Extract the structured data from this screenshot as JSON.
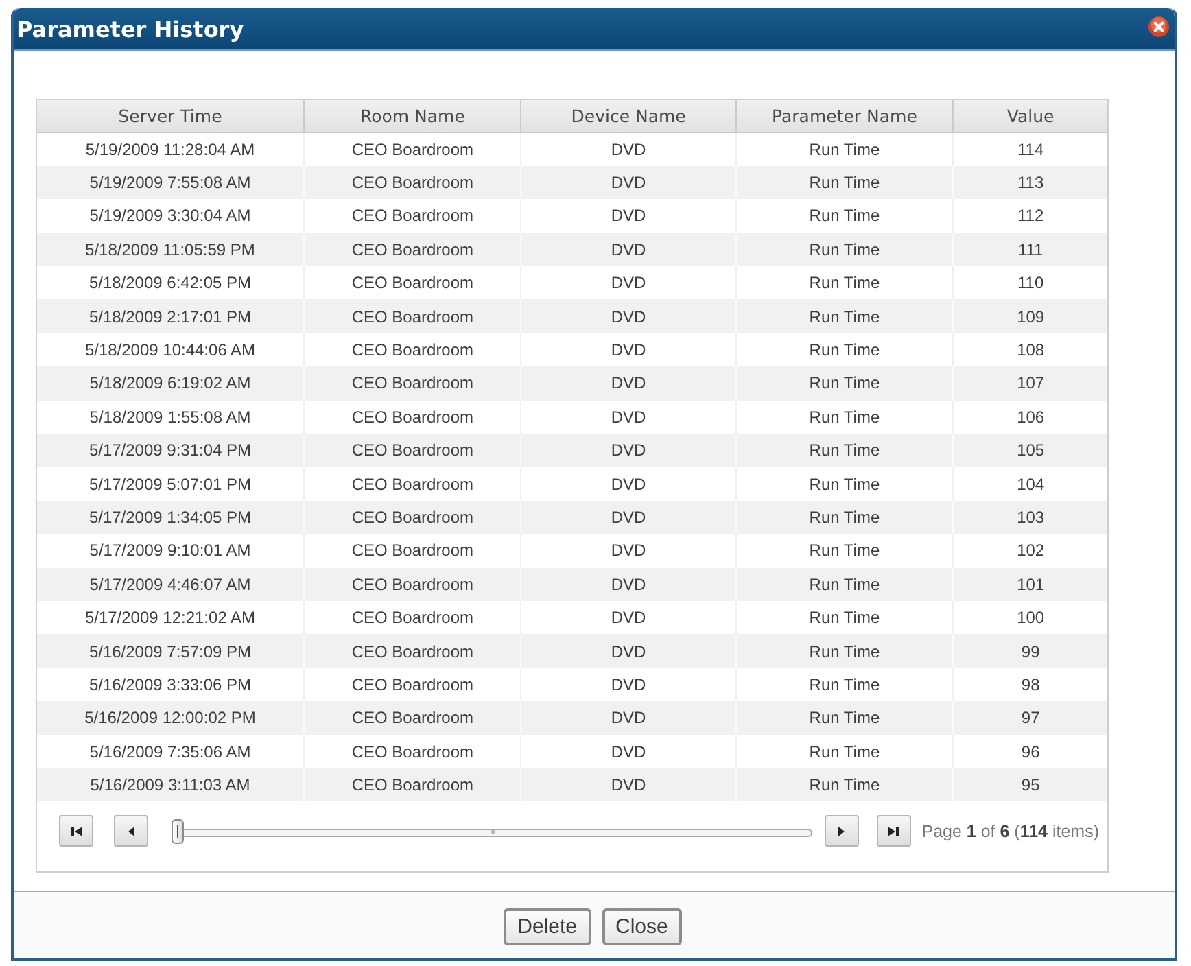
{
  "window": {
    "title": "Parameter History"
  },
  "table": {
    "columns": [
      "Server Time",
      "Room Name",
      "Device Name",
      "Parameter Name",
      "Value"
    ],
    "rows": [
      [
        "5/19/2009 11:28:04 AM",
        "CEO Boardroom",
        "DVD",
        "Run Time",
        "114"
      ],
      [
        "5/19/2009 7:55:08 AM",
        "CEO Boardroom",
        "DVD",
        "Run Time",
        "113"
      ],
      [
        "5/19/2009 3:30:04 AM",
        "CEO Boardroom",
        "DVD",
        "Run Time",
        "112"
      ],
      [
        "5/18/2009 11:05:59 PM",
        "CEO Boardroom",
        "DVD",
        "Run Time",
        "111"
      ],
      [
        "5/18/2009 6:42:05 PM",
        "CEO Boardroom",
        "DVD",
        "Run Time",
        "110"
      ],
      [
        "5/18/2009 2:17:01 PM",
        "CEO Boardroom",
        "DVD",
        "Run Time",
        "109"
      ],
      [
        "5/18/2009 10:44:06 AM",
        "CEO Boardroom",
        "DVD",
        "Run Time",
        "108"
      ],
      [
        "5/18/2009 6:19:02 AM",
        "CEO Boardroom",
        "DVD",
        "Run Time",
        "107"
      ],
      [
        "5/18/2009 1:55:08 AM",
        "CEO Boardroom",
        "DVD",
        "Run Time",
        "106"
      ],
      [
        "5/17/2009 9:31:04 PM",
        "CEO Boardroom",
        "DVD",
        "Run Time",
        "105"
      ],
      [
        "5/17/2009 5:07:01 PM",
        "CEO Boardroom",
        "DVD",
        "Run Time",
        "104"
      ],
      [
        "5/17/2009 1:34:05 PM",
        "CEO Boardroom",
        "DVD",
        "Run Time",
        "103"
      ],
      [
        "5/17/2009 9:10:01 AM",
        "CEO Boardroom",
        "DVD",
        "Run Time",
        "102"
      ],
      [
        "5/17/2009 4:46:07 AM",
        "CEO Boardroom",
        "DVD",
        "Run Time",
        "101"
      ],
      [
        "5/17/2009 12:21:02 AM",
        "CEO Boardroom",
        "DVD",
        "Run Time",
        "100"
      ],
      [
        "5/16/2009 7:57:09 PM",
        "CEO Boardroom",
        "DVD",
        "Run Time",
        "99"
      ],
      [
        "5/16/2009 3:33:06 PM",
        "CEO Boardroom",
        "DVD",
        "Run Time",
        "98"
      ],
      [
        "5/16/2009 12:00:02 PM",
        "CEO Boardroom",
        "DVD",
        "Run Time",
        "97"
      ],
      [
        "5/16/2009 7:35:06 AM",
        "CEO Boardroom",
        "DVD",
        "Run Time",
        "96"
      ],
      [
        "5/16/2009 3:11:03 AM",
        "CEO Boardroom",
        "DVD",
        "Run Time",
        "95"
      ]
    ]
  },
  "pager": {
    "slider": {
      "level": 0
    },
    "info": "Page **1** of **6** (**114** items)"
  },
  "buttons": [
    {
      "label": "Delete"
    },
    {
      "label": "Close"
    }
  ]
}
